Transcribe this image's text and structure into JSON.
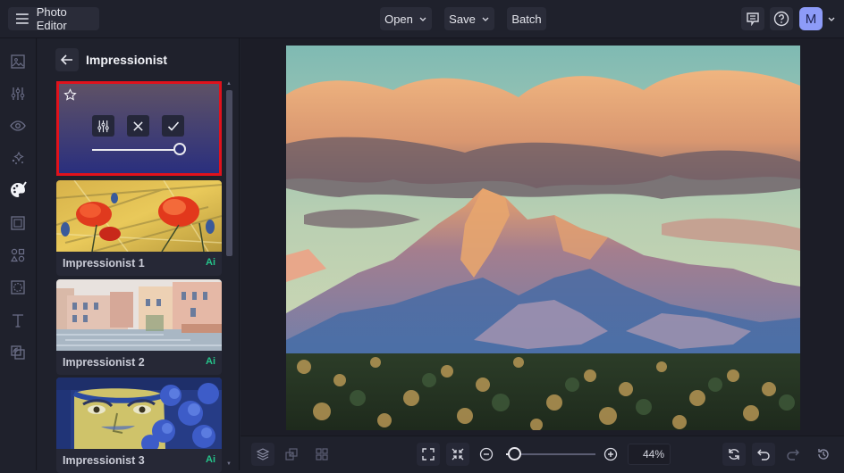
{
  "app": {
    "title": "Photo Editor"
  },
  "toolbar": {
    "open_label": "Open",
    "save_label": "Save",
    "batch_label": "Batch",
    "avatar_initial": "M"
  },
  "leftnav": {
    "items": [
      {
        "name": "image",
        "active": false
      },
      {
        "name": "adjust",
        "active": false
      },
      {
        "name": "eye",
        "active": false
      },
      {
        "name": "effects",
        "active": false
      },
      {
        "name": "artsy",
        "active": true
      },
      {
        "name": "frames",
        "active": false
      },
      {
        "name": "graphics",
        "active": false
      },
      {
        "name": "overlays",
        "active": false
      },
      {
        "name": "text",
        "active": false
      },
      {
        "name": "layers",
        "active": false
      }
    ]
  },
  "panel": {
    "title": "Impressionist",
    "selected_intensity_percent": 100,
    "filters": [
      {
        "label": "Impressionist 1",
        "badge": "Ai"
      },
      {
        "label": "Impressionist 2",
        "badge": "Ai"
      },
      {
        "label": "Impressionist 3",
        "badge": "Ai"
      }
    ]
  },
  "bottombar": {
    "zoom_value": "44%",
    "zoom_percent": 44
  },
  "colors": {
    "accent": "#8d9bf8",
    "selection": "#e0121c",
    "ai_badge": "#25c38a",
    "background": "#1f212c"
  }
}
